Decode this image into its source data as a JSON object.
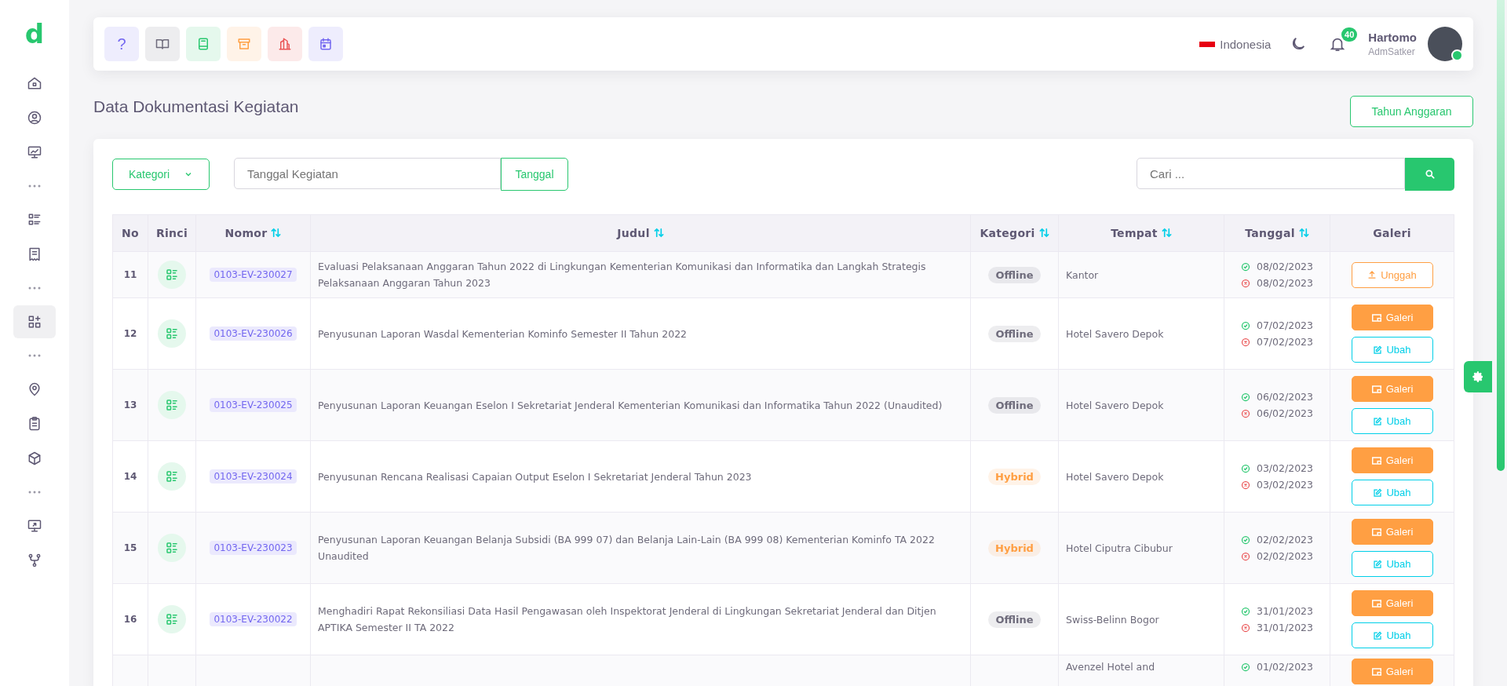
{
  "brand": {
    "logo": "d"
  },
  "sidebar": {
    "items": [
      {
        "kind": "item",
        "selected": false
      },
      {
        "kind": "item",
        "selected": false
      },
      {
        "kind": "item",
        "selected": false
      },
      {
        "kind": "separator"
      },
      {
        "kind": "item",
        "selected": false
      },
      {
        "kind": "item",
        "selected": false
      },
      {
        "kind": "separator"
      },
      {
        "kind": "item",
        "selected": true
      },
      {
        "kind": "separator"
      },
      {
        "kind": "item",
        "selected": false
      },
      {
        "kind": "item",
        "selected": false
      },
      {
        "kind": "item",
        "selected": false
      },
      {
        "kind": "separator"
      },
      {
        "kind": "item",
        "selected": false
      },
      {
        "kind": "item",
        "selected": false
      }
    ]
  },
  "toolbar": [
    {
      "kind": "help",
      "label": "?",
      "color": "#7367f0"
    },
    {
      "kind": "book",
      "color": "#6e6b7b"
    },
    {
      "kind": "notebook",
      "color": "#28c76f"
    },
    {
      "kind": "archive",
      "color": "#ff9f43"
    },
    {
      "kind": "building",
      "color": "#ea5455"
    },
    {
      "kind": "calendar",
      "color": "#7367f0"
    }
  ],
  "header": {
    "language": "Indonesia",
    "notifications": "40",
    "user": {
      "name": "Hartomo",
      "role": "AdmSatker",
      "online": true
    }
  },
  "page": {
    "title": "Data Dokumentasi Kegiatan",
    "budget_year_button": "Tahun Anggaran"
  },
  "filters": {
    "category_button": "Kategori",
    "date_placeholder": "Tanggal Kegiatan",
    "date_button": "Tanggal",
    "search_placeholder": "Cari ..."
  },
  "table": {
    "columns": [
      {
        "label": "No",
        "sortable": false
      },
      {
        "label": "Rinci",
        "sortable": false
      },
      {
        "label": "Nomor",
        "sortable": true
      },
      {
        "label": "Judul",
        "sortable": true
      },
      {
        "label": "Kategori",
        "sortable": true
      },
      {
        "label": "Tempat",
        "sortable": true
      },
      {
        "label": "Tanggal",
        "sortable": true
      },
      {
        "label": "Galeri",
        "sortable": false
      }
    ],
    "rows": [
      {
        "no": "11",
        "nomor": "0103-EV-230027",
        "judul": "Evaluasi Pelaksanaan Anggaran Tahun 2022 di Lingkungan Kementerian Komunikasi dan Informatika dan Langkah Strategis Pelaksanaan Anggaran Tahun 2023",
        "kategori": {
          "label": "Offline",
          "color": "#6e6b7b"
        },
        "tempat": "Kantor",
        "mulai": "08/02/2023",
        "selesai": "08/02/2023",
        "actions": [
          {
            "kind": "upload",
            "label": "Unggah"
          }
        ]
      },
      {
        "no": "12",
        "nomor": "0103-EV-230026",
        "judul": "Penyusunan Laporan Wasdal Kementerian Kominfo Semester II Tahun 2022",
        "kategori": {
          "label": "Offline",
          "color": "#6e6b7b"
        },
        "tempat": "Hotel Savero Depok",
        "mulai": "07/02/2023",
        "selesai": "07/02/2023",
        "actions": [
          {
            "kind": "gallery",
            "label": "Galeri"
          },
          {
            "kind": "edit",
            "label": "Ubah"
          }
        ]
      },
      {
        "no": "13",
        "nomor": "0103-EV-230025",
        "judul": "Penyusunan Laporan Keuangan Eselon I Sekretariat Jenderal Kementerian Komunikasi dan Informatika Tahun 2022 (Unaudited)",
        "kategori": {
          "label": "Offline",
          "color": "#6e6b7b"
        },
        "tempat": "Hotel Savero Depok",
        "mulai": "06/02/2023",
        "selesai": "06/02/2023",
        "actions": [
          {
            "kind": "gallery",
            "label": "Galeri"
          },
          {
            "kind": "edit",
            "label": "Ubah"
          }
        ]
      },
      {
        "no": "14",
        "nomor": "0103-EV-230024",
        "judul": "Penyusunan Rencana Realisasi Capaian Output Eselon I Sekretariat Jenderal Tahun 2023",
        "kategori": {
          "label": "Hybrid",
          "color": "#ff9f43"
        },
        "tempat": "Hotel Savero Depok",
        "mulai": "03/02/2023",
        "selesai": "03/02/2023",
        "actions": [
          {
            "kind": "gallery",
            "label": "Galeri"
          },
          {
            "kind": "edit",
            "label": "Ubah"
          }
        ]
      },
      {
        "no": "15",
        "nomor": "0103-EV-230023",
        "judul": "Penyusunan Laporan Keuangan Belanja Subsidi (BA 999 07) dan Belanja Lain-Lain (BA 999 08) Kementerian Kominfo TA 2022 Unaudited",
        "kategori": {
          "label": "Hybrid",
          "color": "#ff9f43"
        },
        "tempat": "Hotel Ciputra Cibubur",
        "mulai": "02/02/2023",
        "selesai": "02/02/2023",
        "actions": [
          {
            "kind": "gallery",
            "label": "Galeri"
          },
          {
            "kind": "edit",
            "label": "Ubah"
          }
        ]
      },
      {
        "no": "16",
        "nomor": "0103-EV-230022",
        "judul": "Menghadiri Rapat Rekonsiliasi Data Hasil Pengawasan oleh Inspektorat Jenderal di Lingkungan Sekretariat Jenderal dan Ditjen APTIKA Semester II TA 2022",
        "kategori": {
          "label": "Offline",
          "color": "#6e6b7b"
        },
        "tempat": "Swiss-Belinn Bogor",
        "mulai": "31/01/2023",
        "selesai": "31/01/2023",
        "actions": [
          {
            "kind": "gallery",
            "label": "Galeri"
          },
          {
            "kind": "edit",
            "label": "Ubah"
          }
        ]
      },
      {
        "tempat": "Avenzel Hotel and",
        "mulai": "01/02/2023",
        "actions": [
          {
            "kind": "gallery",
            "label": "Galeri"
          }
        ]
      }
    ]
  }
}
